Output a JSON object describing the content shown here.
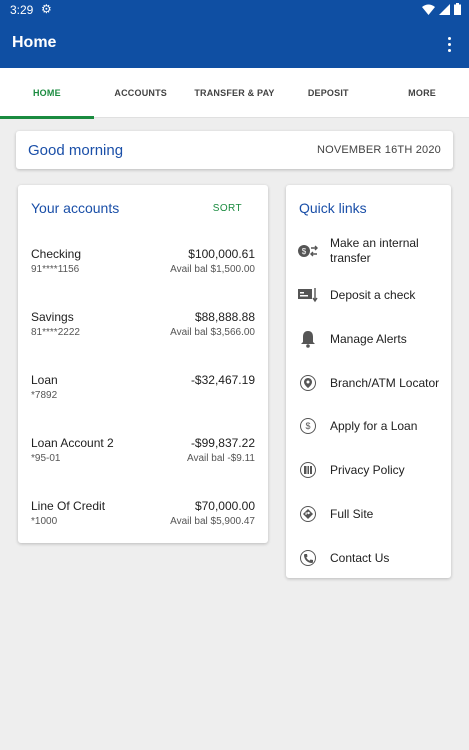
{
  "statusbar": {
    "time": "3:29"
  },
  "appbar": {
    "title": "Home"
  },
  "tabs": [
    {
      "label": "HOME",
      "active": true
    },
    {
      "label": "ACCOUNTS"
    },
    {
      "label": "TRANSFER & PAY"
    },
    {
      "label": "DEPOSIT"
    },
    {
      "label": "MORE"
    }
  ],
  "greeting": {
    "text": "Good morning",
    "date": "NOVEMBER 16TH 2020"
  },
  "accounts": {
    "title": "Your accounts",
    "sort_label": "SORT",
    "items": [
      {
        "name": "Checking",
        "number": "91****1156",
        "balance": "$100,000.61",
        "available": "Avail bal $1,500.00"
      },
      {
        "name": "Savings",
        "number": "81****2222",
        "balance": "$88,888.88",
        "available": "Avail bal $3,566.00"
      },
      {
        "name": "Loan",
        "number": "*7892",
        "balance": "-$32,467.19",
        "available": ""
      },
      {
        "name": "Loan Account 2",
        "number": "*95-01",
        "balance": "-$99,837.22",
        "available": "Avail bal -$9.11"
      },
      {
        "name": "Line Of Credit",
        "number": "*1000",
        "balance": "$70,000.00",
        "available": "Avail bal $5,900.47"
      }
    ]
  },
  "quick_links": {
    "title": "Quick links",
    "items": [
      {
        "label": "Make an internal transfer",
        "icon": "transfer-icon"
      },
      {
        "label": "Deposit a check",
        "icon": "check-deposit-icon"
      },
      {
        "label": "Manage Alerts",
        "icon": "bell-icon"
      },
      {
        "label": "Branch/ATM Locator",
        "icon": "location-pin-icon"
      },
      {
        "label": "Apply for a Loan",
        "icon": "dollar-icon"
      },
      {
        "label": "Privacy Policy",
        "icon": "map-icon"
      },
      {
        "label": "Full Site",
        "icon": "directions-icon"
      },
      {
        "label": "Contact Us",
        "icon": "phone-icon"
      }
    ]
  },
  "colors": {
    "primary": "#0f4fa3",
    "accent_green": "#1a8b3f",
    "link_blue": "#1a4fa8"
  }
}
